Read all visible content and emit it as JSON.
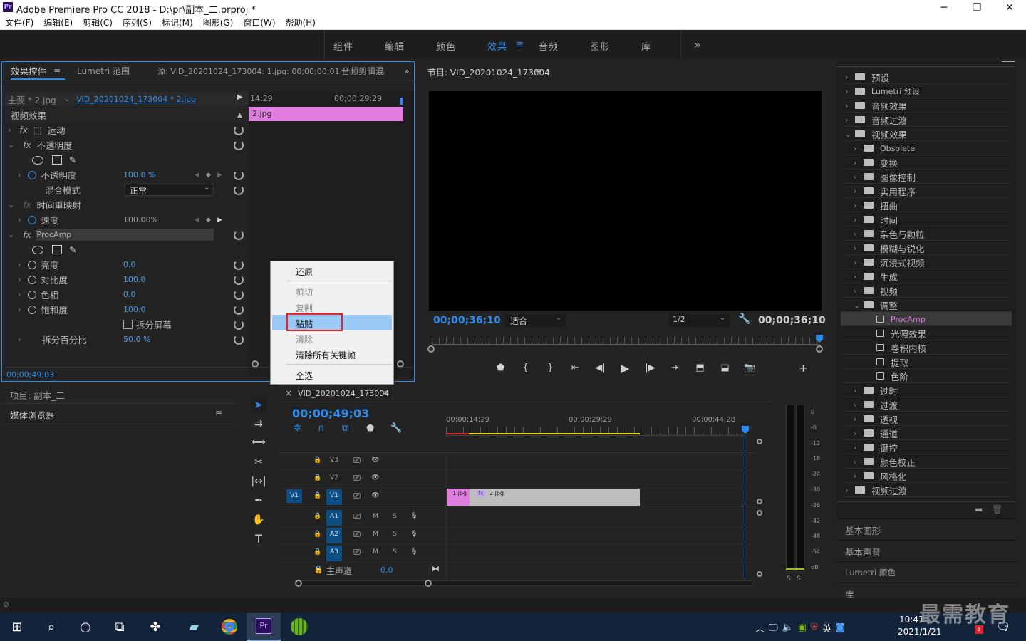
{
  "window": {
    "title": "Adobe Premiere Pro CC 2018 - D:\\pr\\副本_二.prproj *",
    "minimize": "─",
    "maximize": "❐",
    "close": "✕"
  },
  "menu": [
    "文件(F)",
    "编辑(E)",
    "剪辑(C)",
    "序列(S)",
    "标记(M)",
    "图形(G)",
    "窗口(W)",
    "帮助(H)"
  ],
  "workspaces": {
    "items": [
      "组件",
      "编辑",
      "颜色",
      "效果",
      "音频",
      "图形",
      "库"
    ],
    "active": "效果",
    "more": "»"
  },
  "effect_controls": {
    "tabs": [
      "效果控件",
      "Lumetri 范围",
      "源: VID_20201024_173004: 1.jpg: 00;00;00;01",
      "音频剪辑混"
    ],
    "master": "主要 * 2.jpg",
    "sequence_clip": "VID_20201024_173004 * 2.jpg",
    "tc_left": "14;29",
    "tc_right": "00;00;29;29",
    "clip_bar": "2.jpg",
    "section": "视频效果",
    "motion": "运动",
    "opacity_group": "不透明度",
    "opacity_label": "不透明度",
    "opacity_value": "100.0 %",
    "blend_label": "混合模式",
    "blend_value": "正常",
    "time_remap": "时间重映射",
    "speed_label": "速度",
    "speed_value": "100.00%",
    "procamp": "ProcAmp",
    "brightness_label": "亮度",
    "brightness_value": "0.0",
    "contrast_label": "对比度",
    "contrast_value": "100.0",
    "hue_label": "色相",
    "hue_value": "0.0",
    "saturation_label": "饱和度",
    "saturation_value": "100.0",
    "split_screen": "拆分屏幕",
    "split_pct_label": "拆分百分比",
    "split_pct_value": "50.0 %",
    "timecode": "00;00;49;03"
  },
  "context_menu": {
    "items": [
      "还原",
      "剪切",
      "复制",
      "粘贴",
      "清除",
      "清除所有关键帧",
      "全选"
    ],
    "highlighted": "粘贴"
  },
  "program": {
    "title": "节目: VID_20201024_173004",
    "timecode": "00;00;36;10",
    "fit": "适合",
    "resolution": "1/2",
    "duration": "00;00;36;10",
    "playhead": 1.0
  },
  "project": {
    "title": "项目: 副本_二",
    "media_browser": "媒体浏览器"
  },
  "timeline": {
    "title": "VID_20201024_173004",
    "timecode": "00;00;49;03",
    "ruler": [
      "00;00;14;29",
      "00;00;29;29",
      "00;00;44;28"
    ],
    "tracks_video": [
      "V3",
      "V2",
      "V1"
    ],
    "tracks_audio": [
      "A1",
      "A2",
      "A3"
    ],
    "source_v": "V1",
    "master_label": "主声道",
    "master_value": "0.0",
    "clip1": "1.jpg",
    "clip2": "2.jpg",
    "m": "M",
    "s": "S"
  },
  "meter": {
    "labels": [
      "0",
      "-6",
      "-12",
      "-18",
      "-24",
      "-30",
      "-36",
      "-42",
      "-48",
      "-54",
      "dB"
    ],
    "solo": [
      "S",
      "S"
    ]
  },
  "effects_panel": {
    "top": [
      "预设",
      "Lumetri 预设",
      "音频效果",
      "音频过渡",
      "视频效果"
    ],
    "video_effects": [
      "Obsolete",
      "变换",
      "图像控制",
      "实用程序",
      "扭曲",
      "时间",
      "杂色与颗粒",
      "模糊与锐化",
      "沉浸式视频",
      "生成",
      "视频",
      "调整"
    ],
    "adjust_children": [
      "ProcAmp",
      "光照效果",
      "卷积内核",
      "提取",
      "色阶"
    ],
    "after": [
      "过时",
      "过渡",
      "透视",
      "通道",
      "键控",
      "颜色校正",
      "风格化"
    ],
    "last": "视频过渡",
    "selected": "ProcAmp",
    "panels": [
      "基本图形",
      "基本声音",
      "Lumetri 颜色",
      "库"
    ]
  },
  "taskbar": {
    "time": "10:41",
    "date": "2021/1/21",
    "ime": "英",
    "watermark": "最需教育",
    "notify_count": "2",
    "badge": "1"
  },
  "colors": {
    "accent": "#2d8ceb",
    "clip_pink": "#e07ee0",
    "clip_gray": "#bdbdbd",
    "menu_highlight": "#99c9f5",
    "highlight_border": "#e0262b"
  }
}
